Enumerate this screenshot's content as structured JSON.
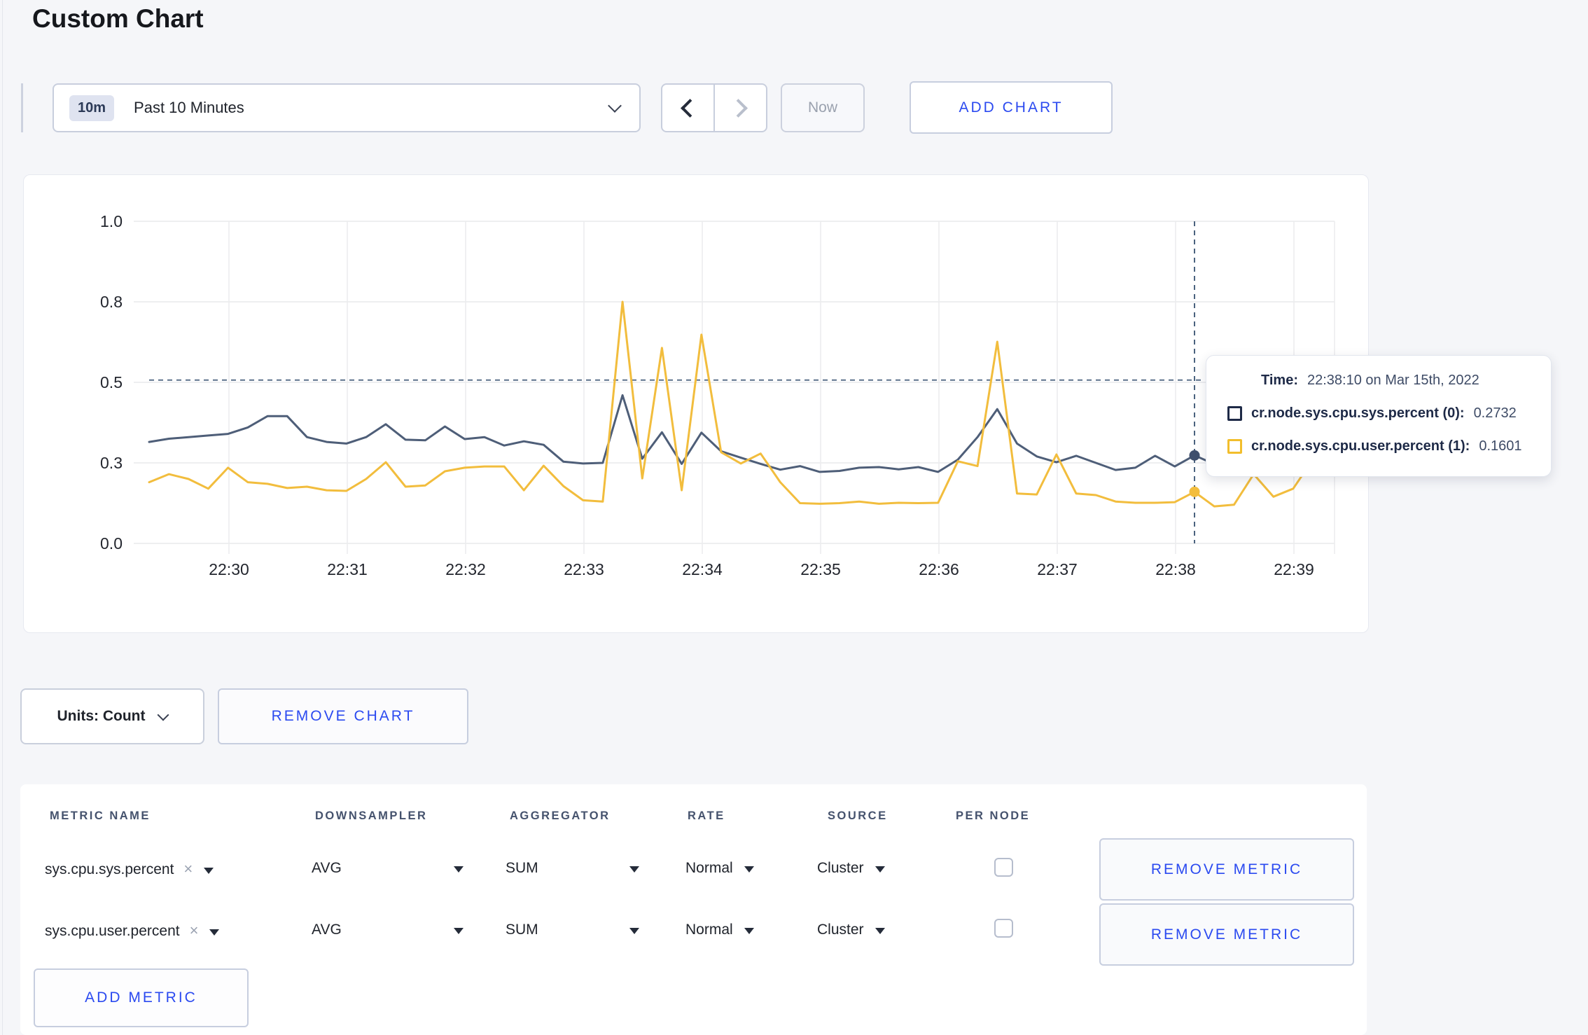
{
  "page": {
    "title": "Custom Chart"
  },
  "toolbar": {
    "time_badge": "10m",
    "time_label": "Past 10 Minutes",
    "now_label": "Now",
    "add_chart_label": "ADD CHART"
  },
  "chart": {
    "units_label": "Units: Count",
    "remove_chart_label": "REMOVE CHART"
  },
  "chart_data": {
    "type": "line",
    "title": "",
    "xlabel": "",
    "ylabel": "",
    "ylim": [
      0,
      1.0
    ],
    "grid": true,
    "legend": "hidden",
    "x_start": "22:29:20",
    "x_interval_seconds": 10,
    "x_tick_labels": [
      "22:30",
      "22:31",
      "22:32",
      "22:33",
      "22:34",
      "22:35",
      "22:36",
      "22:37",
      "22:38",
      "22:39"
    ],
    "y_axis": {
      "ticks": [
        {
          "label": "0.0",
          "value": 0
        },
        {
          "label": "0.3",
          "value": 0.25
        },
        {
          "label": "0.5",
          "value": 0.5
        },
        {
          "label": "0.8",
          "value": 0.75
        },
        {
          "label": "1.0",
          "value": 1.0
        }
      ]
    },
    "series": [
      {
        "name": "cr.node.sys.cpu.sys.percent",
        "color": "#4e5e78",
        "dot_color": "#3f4f6d",
        "values": [
          0.315,
          0.325,
          0.33,
          0.335,
          0.34,
          0.36,
          0.395,
          0.395,
          0.33,
          0.315,
          0.31,
          0.33,
          0.37,
          0.322,
          0.32,
          0.363,
          0.324,
          0.33,
          0.304,
          0.317,
          0.306,
          0.254,
          0.248,
          0.25,
          0.46,
          0.263,
          0.345,
          0.247,
          0.344,
          0.286,
          0.266,
          0.247,
          0.229,
          0.24,
          0.222,
          0.225,
          0.235,
          0.237,
          0.23,
          0.237,
          0.222,
          0.26,
          0.33,
          0.417,
          0.31,
          0.27,
          0.252,
          0.272,
          0.25,
          0.228,
          0.235,
          0.272,
          0.239,
          0.2732,
          0.246,
          0.25,
          0.245,
          0.25,
          0.247,
          0.25
        ]
      },
      {
        "name": "cr.node.sys.cpu.user.percent",
        "color": "#f2bd3d",
        "dot_color": "#f2bd3d",
        "values": [
          0.19,
          0.215,
          0.2,
          0.17,
          0.235,
          0.19,
          0.185,
          0.172,
          0.176,
          0.165,
          0.163,
          0.2,
          0.252,
          0.176,
          0.18,
          0.224,
          0.235,
          0.239,
          0.239,
          0.165,
          0.241,
          0.178,
          0.134,
          0.13,
          0.75,
          0.202,
          0.607,
          0.165,
          0.648,
          0.283,
          0.248,
          0.279,
          0.19,
          0.125,
          0.123,
          0.125,
          0.13,
          0.123,
          0.126,
          0.125,
          0.126,
          0.255,
          0.24,
          0.626,
          0.155,
          0.152,
          0.276,
          0.155,
          0.15,
          0.13,
          0.126,
          0.126,
          0.128,
          0.1601,
          0.115,
          0.12,
          0.215,
          0.145,
          0.17,
          0.26
        ]
      }
    ],
    "hover": {
      "index": 53,
      "time": "22:38:10",
      "values": [
        0.2732,
        0.1601
      ],
      "guide_value": 0.507
    }
  },
  "tooltip": {
    "time_key": "Time:",
    "time_value": "22:38:10 on Mar 15th, 2022",
    "rows": [
      {
        "label": "cr.node.sys.cpu.sys.percent (0):",
        "value": "0.2732",
        "color": "#1e2a47"
      },
      {
        "label": "cr.node.sys.cpu.user.percent (1):",
        "value": "0.1601",
        "color": "#f2be2c"
      }
    ]
  },
  "table": {
    "headers": [
      "METRIC NAME",
      "DOWNSAMPLER",
      "AGGREGATOR",
      "RATE",
      "SOURCE",
      "PER NODE"
    ],
    "rows": [
      {
        "metric": "sys.cpu.sys.percent",
        "close": "×",
        "downsampler": "AVG",
        "aggregator": "SUM",
        "rate": "Normal",
        "source": "Cluster",
        "per_node_checked": false,
        "remove_label": "REMOVE METRIC"
      },
      {
        "metric": "sys.cpu.user.percent",
        "close": "×",
        "downsampler": "AVG",
        "aggregator": "SUM",
        "rate": "Normal",
        "source": "Cluster",
        "per_node_checked": false,
        "remove_label": "REMOVE METRIC"
      }
    ],
    "add_metric_label": "ADD METRIC"
  },
  "colors": {
    "accent_blue": "#2b4af0",
    "crosshair": "#4a627e",
    "gridline": "#ececee",
    "page_background": "#f5f6f9"
  }
}
